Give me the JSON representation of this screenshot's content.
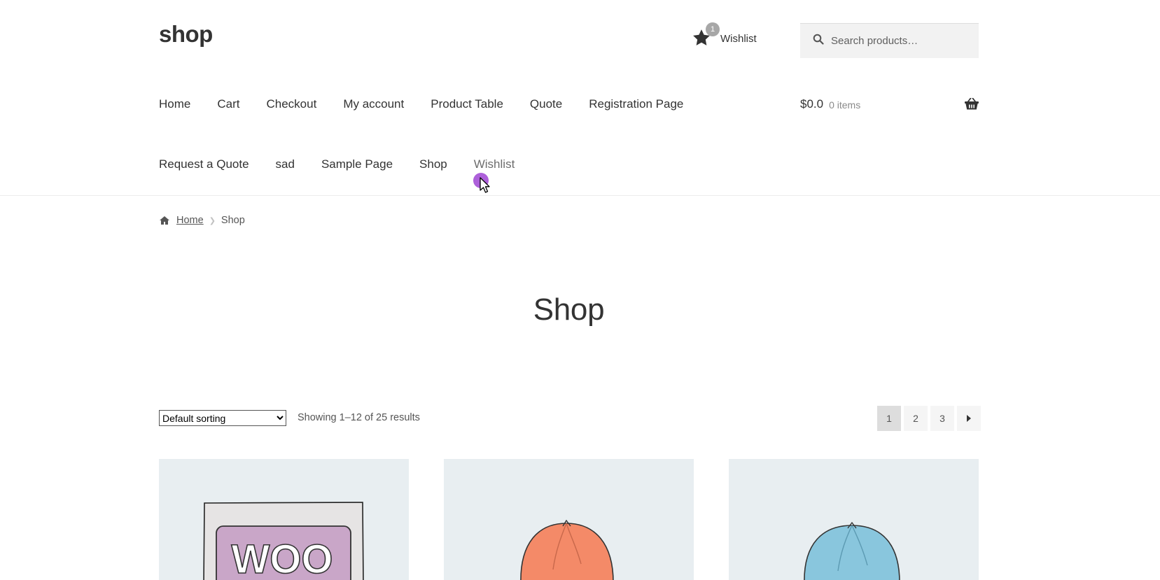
{
  "site": {
    "title": "shop"
  },
  "header": {
    "wishlist": {
      "label": "Wishlist",
      "count": "1"
    },
    "search": {
      "placeholder": "Search products…"
    }
  },
  "nav": {
    "row1": [
      "Home",
      "Cart",
      "Checkout",
      "My account",
      "Product Table",
      "Quote",
      "Registration Page"
    ],
    "row2": [
      "Request a Quote",
      "sad",
      "Sample Page",
      "Shop",
      "Wishlist"
    ]
  },
  "cart": {
    "amount": "$0.0",
    "items": "0 items"
  },
  "breadcrumb": {
    "home": "Home",
    "current": "Shop"
  },
  "page": {
    "title": "Shop"
  },
  "toolbar": {
    "sort": {
      "selected": "Default sorting"
    },
    "result_count": "Showing 1–12 of 25 results"
  },
  "pagination": {
    "pages": [
      "1",
      "2",
      "3"
    ],
    "current": "1",
    "next_icon": "arrow-right-icon"
  },
  "products": [
    {
      "image": "woo-album-image",
      "image_text": "WOO"
    },
    {
      "image": "orange-beanie-image"
    },
    {
      "image": "blue-beanie-image"
    }
  ],
  "colors": {
    "woo_purple": "#c9a6c8",
    "beanie_orange": "#f48a68",
    "beanie_blue": "#89c6dd",
    "product_bg": "#e8eef1",
    "cursor": "#a44fd6"
  }
}
